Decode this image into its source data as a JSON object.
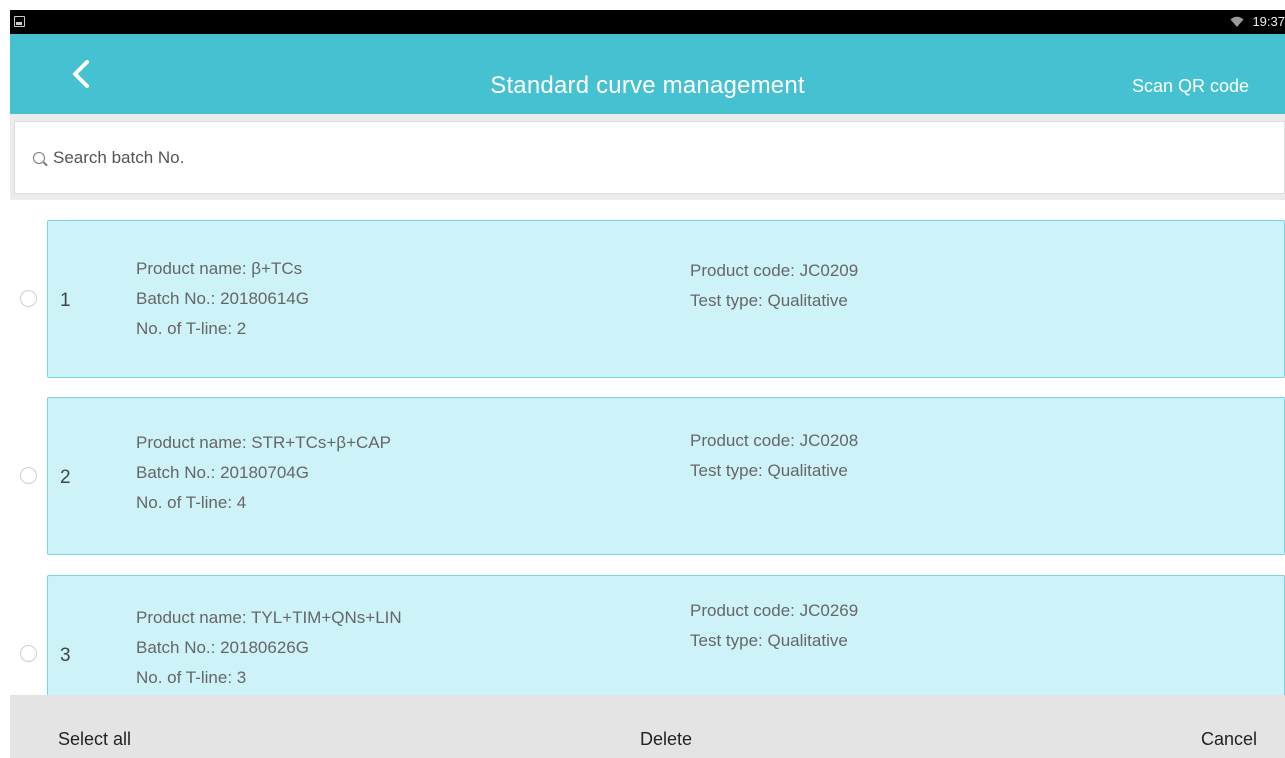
{
  "status_bar": {
    "time": "19:37"
  },
  "header": {
    "title": "Standard curve management",
    "scan_label": "Scan QR code"
  },
  "search": {
    "placeholder": "Search batch No."
  },
  "items": [
    {
      "index": "1",
      "product_name": "Product name: β+TCs",
      "batch_no": "Batch No.: 20180614G",
      "t_line": "No. of T-line: 2",
      "product_code": "Product code: JC0209",
      "test_type": "Test type: Qualitative"
    },
    {
      "index": "2",
      "product_name": "Product name: STR+TCs+β+CAP",
      "batch_no": "Batch No.: 20180704G",
      "t_line": "No. of T-line: 4",
      "product_code": "Product code: JC0208",
      "test_type": "Test type: Qualitative"
    },
    {
      "index": "3",
      "product_name": "Product name: TYL+TIM+QNs+LIN",
      "batch_no": "Batch No.: 20180626G",
      "t_line": "No. of T-line: 3",
      "product_code": "Product code: JC0269",
      "test_type": "Test type: Qualitative"
    }
  ],
  "footer": {
    "select_all": "Select all",
    "delete": "Delete",
    "cancel": "Cancel"
  }
}
